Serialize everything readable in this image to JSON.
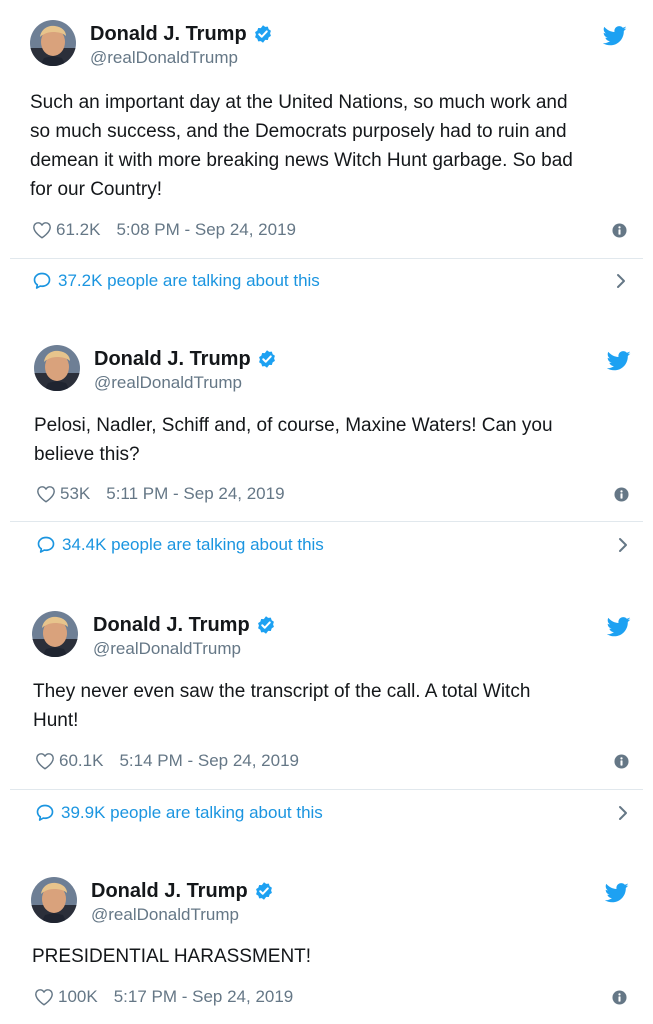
{
  "colors": {
    "twitter_blue": "#1da1f2",
    "link_blue": "#1b95e0",
    "meta_gray": "#657786",
    "divider": "#e1e8ed"
  },
  "icons": [
    "verified-badge-icon",
    "twitter-bird-icon",
    "heart-icon",
    "info-icon",
    "speech-bubble-icon",
    "chevron-right-icon"
  ],
  "tweets": [
    {
      "display_name": "Donald J. Trump",
      "handle": "@realDonaldTrump",
      "text_lines": [
        "Such an important day at the United Nations, so much work and",
        "so much success, and the Democrats purposely had to ruin and",
        "demean it with more breaking news Witch Hunt garbage. So bad",
        "for our Country!"
      ],
      "likes": "61.2K",
      "timestamp": "5:08 PM - Sep 24, 2019",
      "talking": "37.2K people are talking about this"
    },
    {
      "display_name": "Donald J. Trump",
      "handle": "@realDonaldTrump",
      "text_lines": [
        "Pelosi, Nadler, Schiff and, of course, Maxine Waters! Can you",
        "believe this?"
      ],
      "likes": "53K",
      "timestamp": "5:11 PM - Sep 24, 2019",
      "talking": "34.4K people are talking about this"
    },
    {
      "display_name": "Donald J. Trump",
      "handle": "@realDonaldTrump",
      "text_lines": [
        "They never even saw the transcript of the call. A total Witch",
        "Hunt!"
      ],
      "likes": "60.1K",
      "timestamp": "5:14 PM - Sep 24, 2019",
      "talking": "39.9K people are talking about this"
    },
    {
      "display_name": "Donald J. Trump",
      "handle": "@realDonaldTrump",
      "text_lines": [
        "PRESIDENTIAL HARASSMENT!"
      ],
      "likes": "100K",
      "timestamp": "5:17 PM - Sep 24, 2019",
      "talking": ""
    }
  ]
}
